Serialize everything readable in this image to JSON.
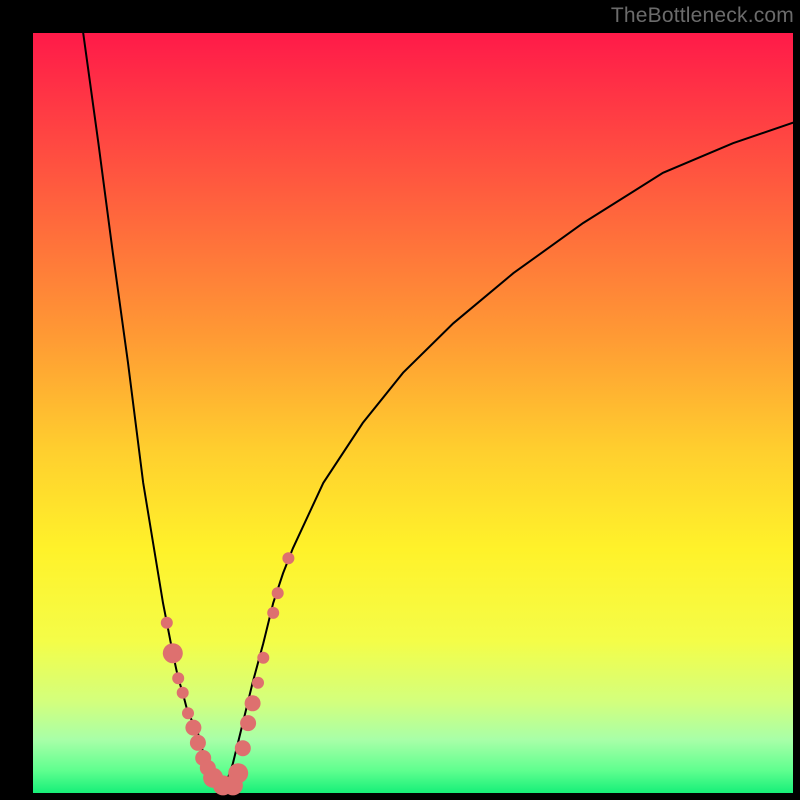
{
  "watermark": "TheBottleneck.com",
  "colors": {
    "grad_top": "#ff1a49",
    "grad_mid_upper": "#ff9a34",
    "grad_mid": "#fff22a",
    "grad_bottom": "#17ef79",
    "curve": "#000000",
    "marker": "#de706f",
    "frame": "#000000"
  },
  "chart_data": {
    "type": "line",
    "title": "",
    "xlabel": "",
    "ylabel": "",
    "xlim": [
      0,
      100
    ],
    "ylim": [
      0,
      100
    ],
    "grid": false,
    "legend": false,
    "series": [
      {
        "name": "left-branch",
        "x": [
          6.6,
          8.6,
          10.5,
          12.5,
          14.5,
          15.8,
          17.1,
          18.4,
          19.1,
          19.7,
          20.4,
          21.1,
          21.7,
          22.4,
          23.0,
          23.7,
          25.0
        ],
        "y": [
          100.0,
          85.5,
          71.1,
          56.6,
          40.8,
          32.9,
          25.0,
          18.4,
          15.1,
          13.2,
          10.5,
          9.2,
          7.9,
          5.3,
          3.9,
          2.6,
          0.0
        ]
      },
      {
        "name": "right-branch",
        "x": [
          25.0,
          26.3,
          27.6,
          28.9,
          30.3,
          31.6,
          32.9,
          34.2,
          38.2,
          43.4,
          48.7,
          55.3,
          63.2,
          72.4,
          82.9,
          92.1,
          100.0
        ],
        "y": [
          0.0,
          3.9,
          9.2,
          14.5,
          19.7,
          25.0,
          28.9,
          32.2,
          40.8,
          48.7,
          55.3,
          61.8,
          68.4,
          75.0,
          81.6,
          85.5,
          88.2
        ]
      }
    ],
    "markers": {
      "name": "highlight-points",
      "color": "#de706f",
      "points": [
        {
          "x": 17.6,
          "y": 22.4,
          "r": 6
        },
        {
          "x": 18.4,
          "y": 18.4,
          "r": 10
        },
        {
          "x": 19.1,
          "y": 15.1,
          "r": 6
        },
        {
          "x": 19.7,
          "y": 13.2,
          "r": 6
        },
        {
          "x": 20.4,
          "y": 10.5,
          "r": 6
        },
        {
          "x": 21.1,
          "y": 8.6,
          "r": 8
        },
        {
          "x": 21.7,
          "y": 6.6,
          "r": 8
        },
        {
          "x": 22.4,
          "y": 4.6,
          "r": 8
        },
        {
          "x": 23.0,
          "y": 3.3,
          "r": 8
        },
        {
          "x": 23.7,
          "y": 2.0,
          "r": 10
        },
        {
          "x": 25.0,
          "y": 1.0,
          "r": 10
        },
        {
          "x": 26.3,
          "y": 1.0,
          "r": 10
        },
        {
          "x": 27.0,
          "y": 2.6,
          "r": 10
        },
        {
          "x": 27.6,
          "y": 5.9,
          "r": 8
        },
        {
          "x": 28.3,
          "y": 9.2,
          "r": 8
        },
        {
          "x": 28.9,
          "y": 11.8,
          "r": 8
        },
        {
          "x": 29.6,
          "y": 14.5,
          "r": 6
        },
        {
          "x": 30.3,
          "y": 17.8,
          "r": 6
        },
        {
          "x": 31.6,
          "y": 23.7,
          "r": 6
        },
        {
          "x": 32.2,
          "y": 26.3,
          "r": 6
        },
        {
          "x": 33.6,
          "y": 30.9,
          "r": 6
        }
      ]
    }
  }
}
